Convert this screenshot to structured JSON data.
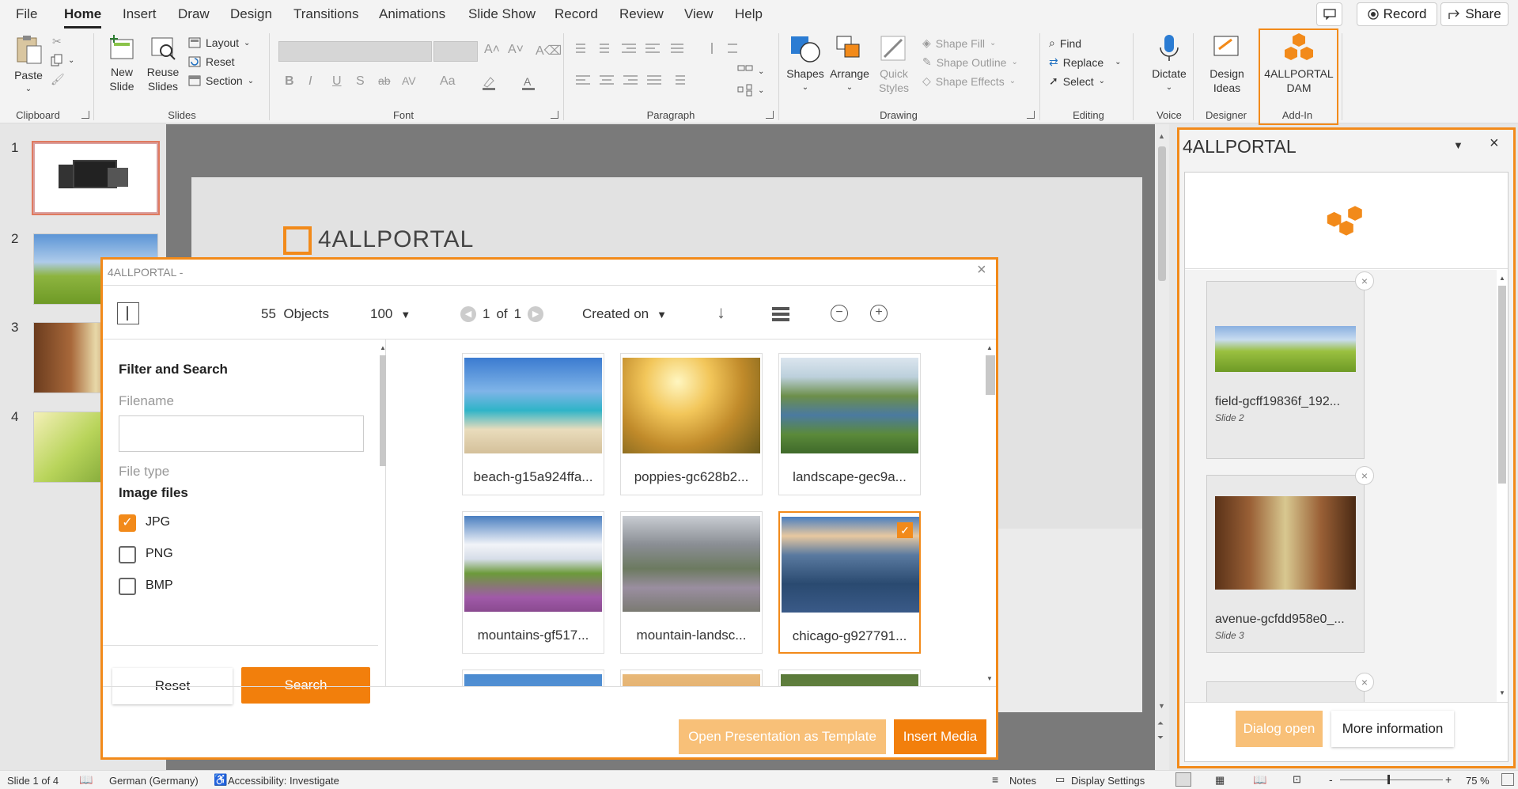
{
  "ribbon_tabs": [
    "File",
    "Home",
    "Insert",
    "Draw",
    "Design",
    "Transitions",
    "Animations",
    "Slide Show",
    "Record",
    "Review",
    "View",
    "Help"
  ],
  "top_buttons": {
    "record": "Record",
    "share": "Share"
  },
  "ribbon": {
    "clipboard": {
      "label": "Clipboard",
      "paste": "Paste"
    },
    "slides": {
      "label": "Slides",
      "new_slide": "New Slide",
      "reuse_slides": "Reuse Slides",
      "layout": "Layout",
      "reset": "Reset",
      "section": "Section"
    },
    "font": {
      "label": "Font",
      "bold": "B",
      "italic": "I",
      "underline": "U",
      "shadow": "S",
      "strike": "ab",
      "spacing": "AV",
      "case": "Aa"
    },
    "paragraph": {
      "label": "Paragraph"
    },
    "drawing": {
      "label": "Drawing",
      "shapes": "Shapes",
      "arrange": "Arrange",
      "quick_styles": "Quick Styles",
      "shape_fill": "Shape Fill",
      "shape_outline": "Shape Outline",
      "shape_effects": "Shape Effects"
    },
    "editing": {
      "label": "Editing",
      "find": "Find",
      "replace": "Replace",
      "select": "Select"
    },
    "voice": {
      "label": "Voice",
      "dictate": "Dictate"
    },
    "designer": {
      "label": "Designer",
      "design_ideas": "Design Ideas"
    },
    "addin": {
      "label": "Add-In",
      "button": "4ALLPORTAL DAM"
    }
  },
  "slides": [
    {
      "num": "1"
    },
    {
      "num": "2"
    },
    {
      "num": "3"
    },
    {
      "num": "4"
    }
  ],
  "slide_logo_text": "4ALLPORTAL",
  "dialog": {
    "title": "4ALLPORTAL -",
    "objects_count": "55",
    "objects_label": "Objects",
    "per_page": "100",
    "page_current": "1",
    "page_of": "of",
    "page_total": "1",
    "sort_by": "Created on",
    "filter_title": "Filter and Search",
    "filename_label": "Filename",
    "filetype_label": "File type",
    "image_files_label": "Image files",
    "filetypes": [
      {
        "label": "JPG",
        "checked": true
      },
      {
        "label": "PNG",
        "checked": false
      },
      {
        "label": "BMP",
        "checked": false
      }
    ],
    "reset": "Reset",
    "search": "Search",
    "images": [
      {
        "name": "beach-g15a924ffa...",
        "selected": false
      },
      {
        "name": "poppies-gc628b2...",
        "selected": false
      },
      {
        "name": "landscape-gec9a...",
        "selected": false
      },
      {
        "name": "mountains-gf517...",
        "selected": false
      },
      {
        "name": "mountain-landsc...",
        "selected": false
      },
      {
        "name": "chicago-g927791...",
        "selected": true
      }
    ],
    "open_template": "Open Presentation as Template",
    "insert_media": "Insert Media"
  },
  "pane": {
    "title": "4ALLPORTAL",
    "items": [
      {
        "name": "field-gcff19836f_192...",
        "slide": "Slide 2"
      },
      {
        "name": "avenue-gcfdd958e0_...",
        "slide": "Slide 3"
      }
    ],
    "dialog_open": "Dialog open",
    "more_info": "More information"
  },
  "statusbar": {
    "slide_info": "Slide 1 of 4",
    "language": "German (Germany)",
    "accessibility": "Accessibility: Investigate",
    "notes": "Notes",
    "display_settings": "Display Settings",
    "zoom_minus": "-",
    "zoom_plus": "+",
    "zoom": "75 %"
  },
  "colors": {
    "accent": "#f28a1a",
    "ribbon_bg": "#f3f3f3",
    "canvas_bg": "#7a7a7a"
  }
}
